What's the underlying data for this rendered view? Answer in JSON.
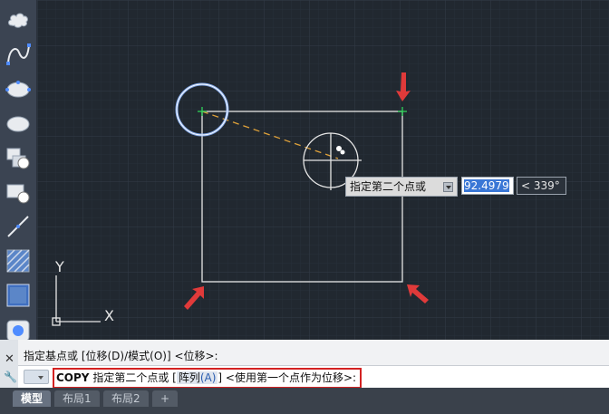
{
  "toolbar": {
    "tools": [
      {
        "icon": "revcloud-icon"
      },
      {
        "icon": "spline-icon"
      },
      {
        "icon": "ellipse-icon"
      },
      {
        "icon": "ellipse-arc-icon"
      },
      {
        "icon": "insert-block-icon"
      },
      {
        "icon": "make-block-icon"
      },
      {
        "icon": "construction-line-icon"
      },
      {
        "icon": "hatch-icon"
      },
      {
        "icon": "region-icon"
      },
      {
        "icon": "boundary-icon"
      }
    ]
  },
  "ucs": {
    "y_label": "Y",
    "x_label": "X"
  },
  "dynamic_input": {
    "prompt": "指定第二个点或",
    "distance": "92.4979",
    "angle": "< 339°"
  },
  "command": {
    "history_line": "指定基点或 [位移(D)/模式(O)] <位移>:",
    "current_cmd": "COPY",
    "prompt_before": " 指定第二个点或 [",
    "option_label": "阵列",
    "option_key": "(A)",
    "prompt_after": "] <使用第一个点作为位移>:"
  },
  "tabs": [
    {
      "label": "模型",
      "active": true
    },
    {
      "label": "布局1",
      "active": false
    },
    {
      "label": "布局2",
      "active": false
    }
  ],
  "add_tab_label": "+",
  "colors": {
    "canvas_bg": "#212830",
    "geometry": "#e6e6e6",
    "rubber_band": "#e0a23a",
    "highlight_circle": "#8fb8ff",
    "arrow": "#e03a3a",
    "osnap": "#2fd35a"
  }
}
